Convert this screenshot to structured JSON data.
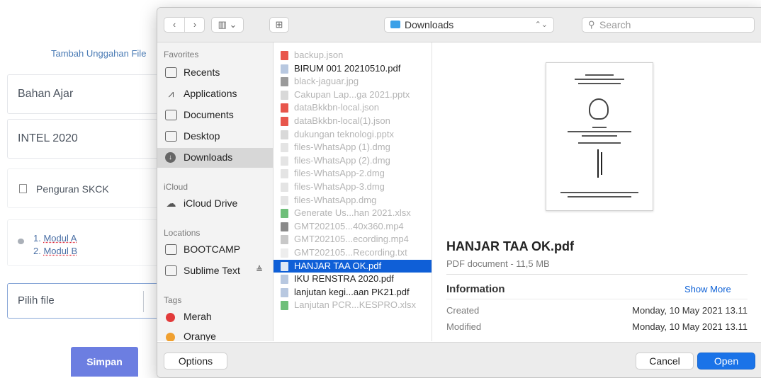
{
  "form": {
    "upload_label": "Tambah Unggahan File",
    "field_bahan": "Bahan Ajar",
    "field_intel": "INTEL 2020",
    "field_skck": "Penguran SKCK",
    "modul_prefix_1": "1. ",
    "modul_name_1": "Modul A",
    "modul_prefix_2": "2. ",
    "modul_name_2": "Modul B",
    "pilih_file": "Pilih file",
    "simpan": "Simpan"
  },
  "dialog": {
    "toolbar": {
      "location": "Downloads",
      "search_placeholder": "Search"
    },
    "sidebar": {
      "favorites_header": "Favorites",
      "favorites": [
        "Recents",
        "Applications",
        "Documents",
        "Desktop",
        "Downloads"
      ],
      "icloud_header": "iCloud",
      "icloud": [
        "iCloud Drive"
      ],
      "locations_header": "Locations",
      "locations": [
        "BOOTCAMP",
        "Sublime Text"
      ],
      "tags_header": "Tags",
      "tags": [
        {
          "label": "Merah",
          "color": "#e23b3b"
        },
        {
          "label": "Oranye",
          "color": "#f0a030"
        }
      ]
    },
    "files": [
      {
        "name": "backup.json",
        "state": "dim",
        "icon_color": "#e8564c"
      },
      {
        "name": "BIRUM 001 20210510.pdf",
        "state": "on",
        "icon_color": "#b8c8e0"
      },
      {
        "name": "black-jaguar.jpg",
        "state": "dim",
        "icon_color": "#9a9a9a"
      },
      {
        "name": "Cakupan Lap...ga 2021.pptx",
        "state": "dim",
        "icon_color": "#d9d9d9"
      },
      {
        "name": "dataBkkbn-local.json",
        "state": "dim",
        "icon_color": "#e8564c"
      },
      {
        "name": "dataBkkbn-local(1).json",
        "state": "dim",
        "icon_color": "#e8564c"
      },
      {
        "name": "dukungan teknologi.pptx",
        "state": "dim",
        "icon_color": "#d9d9d9"
      },
      {
        "name": "files-WhatsApp (1).dmg",
        "state": "dim",
        "icon_color": "#e4e4e4"
      },
      {
        "name": "files-WhatsApp (2).dmg",
        "state": "dim",
        "icon_color": "#e4e4e4"
      },
      {
        "name": "files-WhatsApp-2.dmg",
        "state": "dim",
        "icon_color": "#e4e4e4"
      },
      {
        "name": "files-WhatsApp-3.dmg",
        "state": "dim",
        "icon_color": "#e4e4e4"
      },
      {
        "name": "files-WhatsApp.dmg",
        "state": "dim",
        "icon_color": "#e4e4e4"
      },
      {
        "name": "Generate Us...han 2021.xlsx",
        "state": "dim",
        "icon_color": "#6fbf7a"
      },
      {
        "name": "GMT202105...40x360.mp4",
        "state": "dim",
        "icon_color": "#8a8a8a"
      },
      {
        "name": "GMT202105...ecording.mp4",
        "state": "dim",
        "icon_color": "#c8c8c8"
      },
      {
        "name": "GMT202105...Recording.txt",
        "state": "dim",
        "icon_color": "#ededed"
      },
      {
        "name": "HANJAR TAA OK.pdf",
        "state": "sel",
        "icon_color": "#dfe8f5"
      },
      {
        "name": "IKU RENSTRA 2020.pdf",
        "state": "on",
        "icon_color": "#b8c8e0"
      },
      {
        "name": "lanjutan kegi...aan PK21.pdf",
        "state": "on",
        "icon_color": "#b8c8e0"
      },
      {
        "name": "Lanjutan PCR...KESPRO.xlsx",
        "state": "dim",
        "icon_color": "#6fbf7a"
      }
    ],
    "preview": {
      "title": "HANJAR TAA OK.pdf",
      "subtitle": "PDF document - 11,5 MB",
      "info_header": "Information",
      "show_more": "Show More",
      "created_label": "Created",
      "created_value": "Monday, 10 May 2021 13.11",
      "modified_label": "Modified",
      "modified_value": "Monday, 10 May 2021 13.11"
    },
    "buttons": {
      "options": "Options",
      "cancel": "Cancel",
      "open": "Open"
    }
  }
}
